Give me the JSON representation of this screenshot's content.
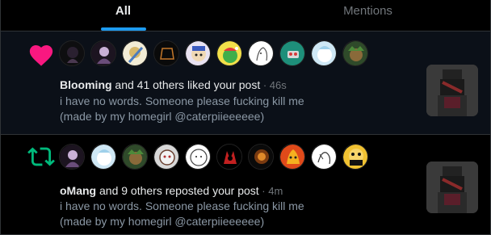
{
  "tabs": [
    {
      "label": "All",
      "active": true
    },
    {
      "label": "Mentions",
      "active": false
    }
  ],
  "notifications": [
    {
      "kind": "like",
      "icon": "heart-icon",
      "icon_color": "#f91880",
      "user": "Blooming",
      "action": " and 41 others liked your post",
      "time": " · 46s",
      "text_line1": "i have no words. Someone please fucking kill me",
      "text_line2": "(made by my homegirl @caterpiieeeeee)"
    },
    {
      "kind": "repost",
      "icon": "repost-icon",
      "icon_color": "#00ba7c",
      "user": "oMang",
      "action": " and 9 others reposted your post",
      "time": " · 4m",
      "text_line1": "i have no words. Someone please fucking kill me",
      "text_line2": "(made by my homegirl @caterpiieeeeee)"
    }
  ],
  "colors": {
    "accent": "#1d9bf0",
    "like": "#f91880",
    "repost": "#00ba7c"
  }
}
